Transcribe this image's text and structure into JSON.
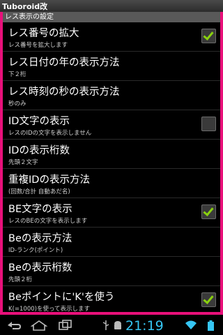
{
  "app": {
    "title": "Tuboroid改"
  },
  "section": {
    "header": "レス表示の設定"
  },
  "settings": [
    {
      "title": "レス番号の拡大",
      "summary": "レス番号を拡大します",
      "checkbox": true,
      "checked": true
    },
    {
      "title": "レス日付の年の表示方法",
      "summary": "下２桁",
      "checkbox": false
    },
    {
      "title": "レス時刻の秒の表示方法",
      "summary": "秒のみ",
      "checkbox": false
    },
    {
      "title": "ID文字の表示",
      "summary": "レスのIDの文字を表示しません",
      "checkbox": true,
      "checked": false
    },
    {
      "title": "IDの表示桁数",
      "summary": "先頭２文字",
      "checkbox": false
    },
    {
      "title": "重複IDの表示方法",
      "summary": "(回数/合計 自動あだ名)",
      "checkbox": false
    },
    {
      "title": "BE文字の表示",
      "summary": "レスのBEの文字を表示します",
      "checkbox": true,
      "checked": true
    },
    {
      "title": "Beの表示方法",
      "summary": "ID-ランク(ポイント)",
      "checkbox": false
    },
    {
      "title": "Beの表示桁数",
      "summary": "先頭２桁",
      "checkbox": false
    },
    {
      "title": "Beポイントに'K'を使う",
      "summary": "K(=1000)を使って表示します",
      "checkbox": true,
      "checked": true
    }
  ],
  "navbar": {
    "icons": [
      "back-icon",
      "home-icon",
      "recent-apps-icon",
      "usb-icon",
      "android-debug-icon",
      "wifi-icon",
      "battery-icon"
    ],
    "clock": "21:19"
  },
  "colors": {
    "frame": "#e8107a",
    "check": "#8ad10f",
    "clock": "#36c6f4"
  }
}
